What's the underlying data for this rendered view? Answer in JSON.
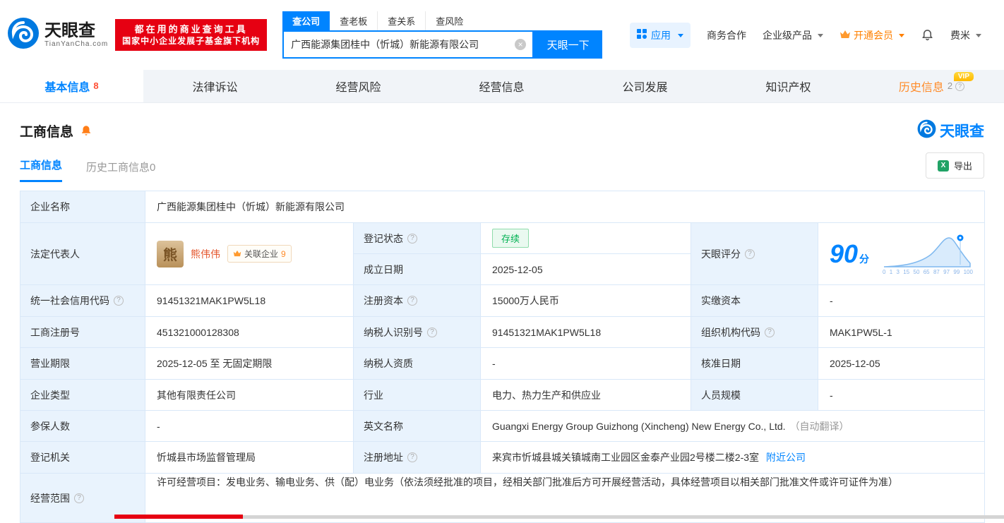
{
  "colors": {
    "brand_blue": "#0084ff",
    "promo_red": "#e60012",
    "vip_orange": "#ff8b29",
    "status_green": "#00b152"
  },
  "header": {
    "logo_title": "天眼查",
    "logo_subtitle": "TianYanCha.com",
    "promo_line1": "都在用的商业查询工具",
    "promo_line2": "国家中小企业发展子基金旗下机构",
    "search_tabs": [
      {
        "label": "查公司"
      },
      {
        "label": "查老板"
      },
      {
        "label": "查关系"
      },
      {
        "label": "查风险"
      }
    ],
    "search_value": "广西能源集团桂中（忻城）新能源有限公司",
    "search_button": "天眼一下",
    "apps_label": "应用",
    "cooperation_label": "商务合作",
    "enterprise_label": "企业级产品",
    "vip_label": "开通会员",
    "user_label": "费米"
  },
  "nav": {
    "tabs": [
      {
        "label": "基本信息",
        "count": "8"
      },
      {
        "label": "法律诉讼"
      },
      {
        "label": "经营风险"
      },
      {
        "label": "经营信息"
      },
      {
        "label": "公司发展"
      },
      {
        "label": "知识产权"
      },
      {
        "label": "历史信息",
        "count": "2",
        "vip": "VIP"
      }
    ]
  },
  "section": {
    "title": "工商信息",
    "brand": "天眼查",
    "subtab_active": "工商信息",
    "subtab_history": "历史工商信息0",
    "export_label": "导出"
  },
  "table": {
    "company_name": {
      "label": "企业名称",
      "value": "广西能源集团桂中（忻城）新能源有限公司"
    },
    "legal_rep": {
      "label": "法定代表人",
      "avatar": "熊",
      "name": "熊伟伟",
      "badge": "关联企业",
      "badge_count": "9"
    },
    "reg_status": {
      "label": "登记状态",
      "value": "存续"
    },
    "establish_date": {
      "label": "成立日期",
      "value": "2025-12-05"
    },
    "score": {
      "label": "天眼评分",
      "value": "90",
      "unit": "分",
      "ticks": [
        "0",
        "1",
        "3",
        "15",
        "50",
        "65",
        "87",
        "97",
        "99",
        "100"
      ]
    },
    "credit_code": {
      "label": "统一社会信用代码",
      "value": "91451321MAK1PW5L18"
    },
    "reg_capital": {
      "label": "注册资本",
      "value": "15000万人民币"
    },
    "paid_capital": {
      "label": "实缴资本",
      "value": "-"
    },
    "reg_number": {
      "label": "工商注册号",
      "value": "451321000128308"
    },
    "taxpayer_id": {
      "label": "纳税人识别号",
      "value": "91451321MAK1PW5L18"
    },
    "org_code": {
      "label": "组织机构代码",
      "value": "MAK1PW5L-1"
    },
    "business_term": {
      "label": "营业期限",
      "value": "2025-12-05 至 无固定期限"
    },
    "taxpayer_qualification": {
      "label": "纳税人资质",
      "value": "-"
    },
    "approval_date": {
      "label": "核准日期",
      "value": "2025-12-05"
    },
    "company_type": {
      "label": "企业类型",
      "value": "其他有限责任公司"
    },
    "industry": {
      "label": "行业",
      "value": "电力、热力生产和供应业"
    },
    "staff_size": {
      "label": "人员规模",
      "value": "-"
    },
    "insured_count": {
      "label": "参保人数",
      "value": "-"
    },
    "english_name": {
      "label": "英文名称",
      "value": "Guangxi Energy Group Guizhong (Xincheng) New Energy Co., Ltd.",
      "note": "（自动翻译）"
    },
    "reg_authority": {
      "label": "登记机关",
      "value": "忻城县市场监督管理局"
    },
    "reg_address": {
      "label": "注册地址",
      "value": "来宾市忻城县城关镇城南工业园区金泰产业园2号楼二楼2-3室",
      "link": "附近公司"
    },
    "business_scope": {
      "label": "经营范围",
      "value": "许可经营项目：发电业务、输电业务、供（配）电业务（依法须经批准的项目，经相关部门批准后方可开展经营活动，具体经营项目以相关部门批准文件或许可证件为准）"
    }
  }
}
